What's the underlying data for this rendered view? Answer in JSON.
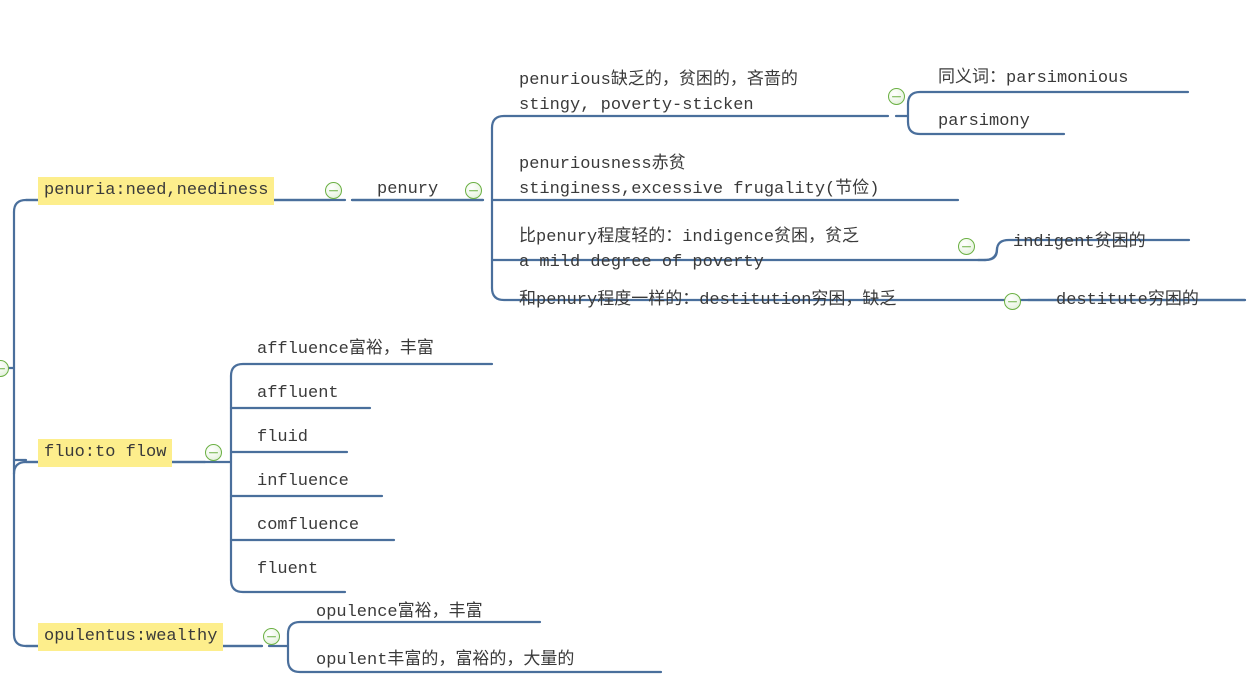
{
  "document": {
    "title": "Latin roots vocabulary mind map",
    "background_color": "#ffffff",
    "line_color": "#4a6f9c",
    "text_color": "#3a3a3a",
    "highlight_color": "#fdee8c",
    "toggle_color": "#6bb043"
  },
  "nodes": {
    "root_toggle": "collapse-toggle",
    "branch1": {
      "label": "penuria:need,neediness",
      "highlighted": true,
      "child": {
        "label": "penury",
        "highlighted": false,
        "items": [
          {
            "line1": "penurious缺乏的，贫困的，吝啬的",
            "line2": "stingy, poverty-sticken",
            "subitems": [
              {
                "label": "同义词：parsimonious"
              },
              {
                "label": "parsimony"
              }
            ]
          },
          {
            "line1": "penuriousness赤贫",
            "line2": "stinginess,excessive frugality(节俭)",
            "subitems": []
          },
          {
            "line1": "比penury程度轻的：indigence贫困，贫乏",
            "line2": "a mild degree of poverty",
            "subitems": [
              {
                "label": "indigent贫困的"
              }
            ]
          },
          {
            "line1": "和penury程度一样的：destitution穷困，缺乏",
            "line2": "",
            "subitems": [
              {
                "label": "destitute穷困的"
              }
            ]
          }
        ]
      }
    },
    "branch2": {
      "label": "fluo:to flow",
      "highlighted": true,
      "items": [
        {
          "label": "affluence富裕，丰富"
        },
        {
          "label": "affluent"
        },
        {
          "label": "fluid"
        },
        {
          "label": "influence"
        },
        {
          "label": "comfluence"
        },
        {
          "label": "fluent"
        }
      ]
    },
    "branch3": {
      "label": "opulentus:wealthy",
      "highlighted": true,
      "items": [
        {
          "label": "opulence富裕，丰富"
        },
        {
          "label": "opulent丰富的，富裕的，大量的"
        }
      ]
    }
  }
}
